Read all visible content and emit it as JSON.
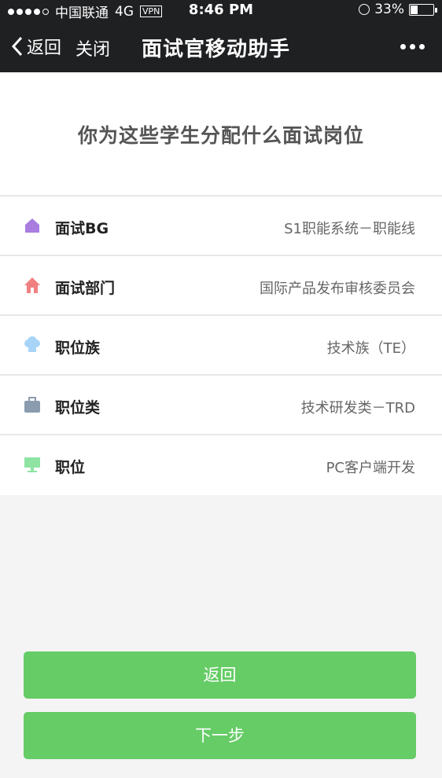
{
  "status_bar": {
    "carrier": "中国联通",
    "network": "4G",
    "vpn": "VPN",
    "time": "8:46 PM",
    "battery_text": "33%",
    "battery_level": 0.33
  },
  "navbar": {
    "back_label": "返回",
    "close_label": "关闭",
    "title": "面试官移动助手",
    "more_icon": "more-dots-icon"
  },
  "heading": "你为这些学生分配什么面试岗位",
  "rows": [
    {
      "label": "面试BG",
      "value": "S1职能系统－职能线",
      "icon": "building-icon",
      "color": "#a97de0"
    },
    {
      "label": "面试部门",
      "value": "国际产品发布审核委员会",
      "icon": "home-icon",
      "color": "#f08080"
    },
    {
      "label": "职位族",
      "value": "技术族（TE）",
      "icon": "chef-hat-icon",
      "color": "#a8d4f8"
    },
    {
      "label": "职位类",
      "value": "技术研发类－TRD",
      "icon": "briefcase-icon",
      "color": "#8a9cae"
    },
    {
      "label": "职位",
      "value": "PC客户端开发",
      "icon": "desktop-icon",
      "color": "#8fe3a3"
    }
  ],
  "buttons": {
    "back": "返回",
    "next": "下一步"
  },
  "colors": {
    "nav_bg": "#1f2022",
    "button_green": "#66cc66",
    "page_bg": "#f4f4f5"
  }
}
